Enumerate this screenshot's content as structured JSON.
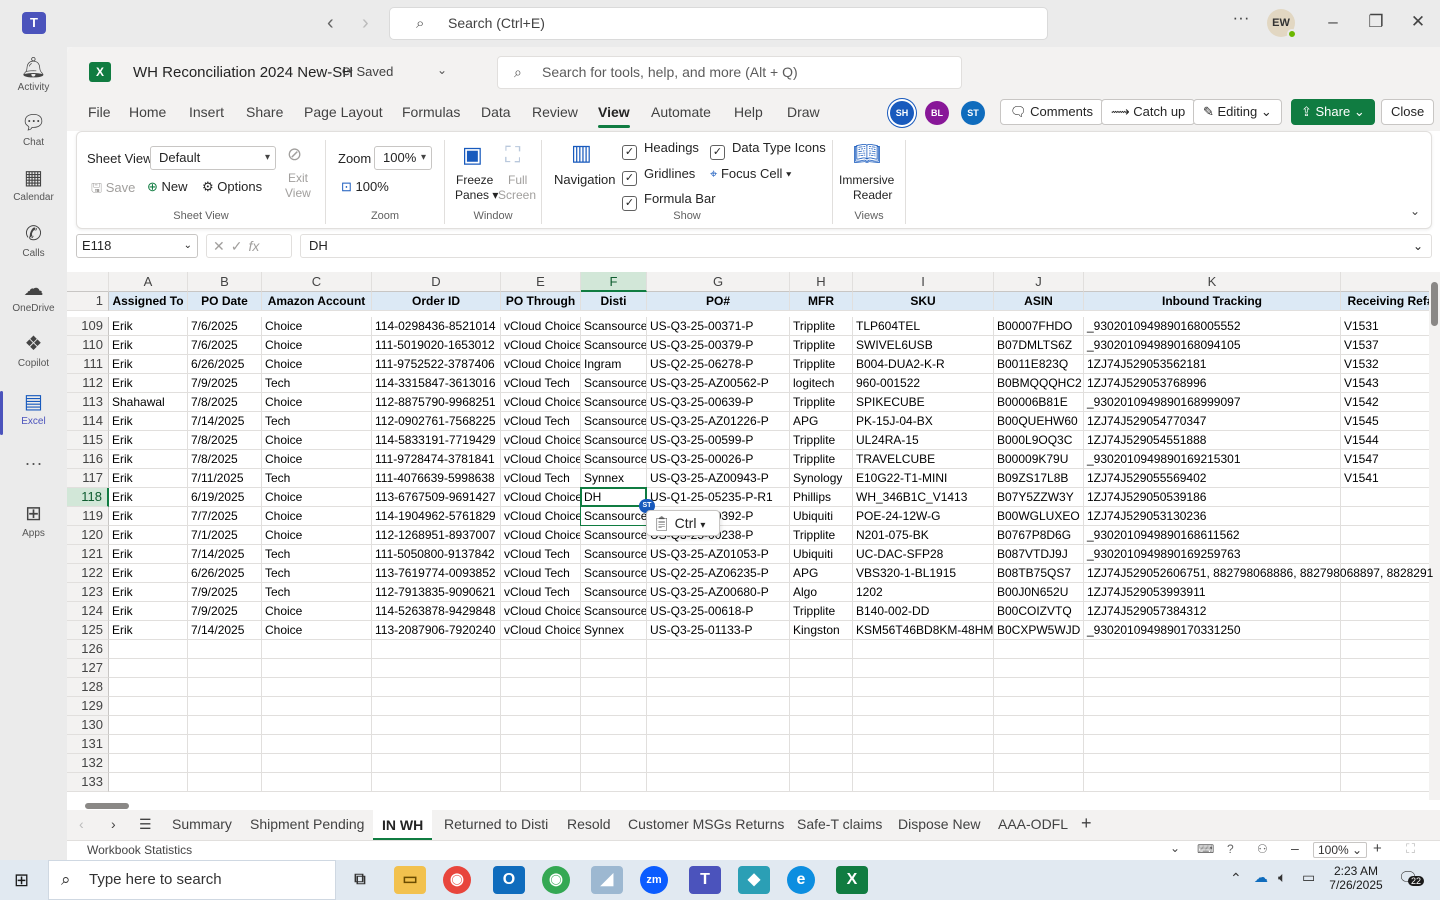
{
  "teams": {
    "search_placeholder": "Search (Ctrl+E)",
    "avatar_initials": "EW",
    "rail": [
      {
        "label": "Activity",
        "icon": "bell-icon"
      },
      {
        "label": "Chat",
        "icon": "chat-icon"
      },
      {
        "label": "Calendar",
        "icon": "calendar-icon"
      },
      {
        "label": "Calls",
        "icon": "phone-icon"
      },
      {
        "label": "OneDrive",
        "icon": "cloud-icon"
      },
      {
        "label": "Copilot",
        "icon": "copilot-icon"
      },
      {
        "label": "Excel",
        "icon": "excel-icon",
        "active": true
      },
      {
        "label": "Apps",
        "icon": "add-apps-icon"
      }
    ]
  },
  "excel": {
    "workbook_name": "WH Reconciliation 2024 New-SH",
    "save_status": "Saved",
    "search_placeholder": "Search for tools, help, and more (Alt + Q)",
    "tabs": [
      "File",
      "Home",
      "Insert",
      "Share",
      "Page Layout",
      "Formulas",
      "Data",
      "Review",
      "View",
      "Automate",
      "Help",
      "Draw"
    ],
    "active_tab": "View",
    "coauthors": [
      {
        "initials": "SH",
        "color": "#185abd"
      },
      {
        "initials": "BL",
        "color": "#881798"
      },
      {
        "initials": "ST",
        "color": "#0f6cbd"
      }
    ],
    "buttons": {
      "comments": "Comments",
      "catchup": "Catch up",
      "editing": "Editing",
      "share": "Share",
      "close": "Close"
    },
    "ribbon": {
      "sheet_view_label": "Sheet View",
      "sheet_view_value": "Default",
      "save": "Save",
      "new": "New",
      "options": "Options",
      "exit_view_1": "Exit",
      "exit_view_2": "View",
      "group_sheet_view": "Sheet View",
      "zoom_label": "Zoom",
      "zoom_value": "100%",
      "zoom_100": "100%",
      "group_zoom": "Zoom",
      "freeze_1": "Freeze",
      "freeze_2": "Panes",
      "full_1": "Full",
      "full_2": "Screen",
      "group_window": "Window",
      "navigation": "Navigation",
      "headings": "Headings",
      "gridlines": "Gridlines",
      "formula_bar": "Formula Bar",
      "data_type_icons": "Data Type Icons",
      "focus_cell": "Focus Cell",
      "group_show": "Show",
      "immersive_1": "Immersive",
      "immersive_2": "Reader",
      "group_views": "Views"
    },
    "name_box": "E118",
    "formula": "DH",
    "fx": "fx",
    "columns": [
      "A",
      "B",
      "C",
      "D",
      "E",
      "F",
      "G",
      "H",
      "I",
      "J",
      "K"
    ],
    "header_row": {
      "num": "1",
      "cells": [
        "Assigned To",
        "PO Date",
        "Amazon Account",
        "Order ID",
        "PO Through",
        "Disti",
        "PO#",
        "MFR",
        "SKU",
        "ASIN",
        "Inbound Tracking",
        "Receiving Ref#"
      ]
    },
    "rows": [
      {
        "num": "109",
        "cells": [
          "Erik",
          "7/6/2025",
          "Choice",
          "114-0298436-8521014",
          "vCloud Choice",
          "Scansource",
          "US-Q3-25-00371-P",
          "Tripplite",
          "TLP604TEL",
          "B00007FHDO",
          "_930201094989016800555​2",
          "V1531"
        ]
      },
      {
        "num": "110",
        "cells": [
          "Erik",
          "7/6/2025",
          "Choice",
          "111-5019020-1653012",
          "vCloud Choice",
          "Scansource",
          "US-Q3-25-00379-P",
          "Tripplite",
          "SWIVEL6USB",
          "B07DMLTS6Z",
          "_930201094989016809410​5",
          "V1537"
        ]
      },
      {
        "num": "111",
        "cells": [
          "Erik",
          "6/26/2025",
          "Choice",
          "111-9752522-3787406",
          "vCloud Choice",
          "Ingram",
          "US-Q2-25-06278-P",
          "Tripplite",
          "B004-DUA2-K-R",
          "B0011E823Q",
          "1ZJ74J529053562181",
          "V1532"
        ]
      },
      {
        "num": "112",
        "cells": [
          "Erik",
          "7/9/2025",
          "Tech",
          "114-3315847-3613016",
          "vCloud Tech",
          "Scansource",
          "US-Q3-25-AZ00562-P",
          "logitech",
          "960-001522",
          "B0BMQQQHC2",
          "1ZJ74J529053768996",
          "V1543"
        ]
      },
      {
        "num": "113",
        "cells": [
          "Shahawal",
          "7/8/2025",
          "Choice",
          "112-8875790-9968251",
          "vCloud Choice",
          "Scansource",
          "US-Q3-25-00639-P",
          "Tripplite",
          "SPIKECUBE",
          "B00006B81E",
          "_930201094989016899909​7",
          "V1542"
        ]
      },
      {
        "num": "114",
        "cells": [
          "Erik",
          "7/14/2025",
          "Tech",
          "112-0902761-7568225",
          "vCloud Tech",
          "Scansource",
          "US-Q3-25-AZ01226-P",
          "APG",
          "PK-15J-04-BX",
          "B00QUEHW60",
          "1ZJ74J529054770347",
          "V1545"
        ]
      },
      {
        "num": "115",
        "cells": [
          "Erik",
          "7/8/2025",
          "Choice",
          "114-5833191-7719429",
          "vCloud Choice",
          "Scansource",
          "US-Q3-25-00599-P",
          "Tripplite",
          "UL24RA-15",
          "B000L9OQ3C",
          "1ZJ74J529054551888",
          "V1544"
        ]
      },
      {
        "num": "116",
        "cells": [
          "Erik",
          "7/8/2025",
          "Choice",
          "111-9728474-3781841",
          "vCloud Choice",
          "Scansource",
          "US-Q3-25-00026-P",
          "Tripplite",
          "TRAVELCUBE",
          "B00009K79U",
          "_930201094989016921530​1",
          "V1547"
        ]
      },
      {
        "num": "117",
        "cells": [
          "Erik",
          "7/11/2025",
          "Tech",
          "111-4076639-5998638",
          "vCloud Tech",
          "Synnex",
          "US-Q3-25-AZ00943-P",
          "Synology",
          "E10G22-T1-MINI",
          "B09ZS17L8B",
          "1ZJ74J529055569402",
          "V1541"
        ]
      },
      {
        "num": "118",
        "cells": [
          "Erik",
          "6/19/2025",
          "Choice",
          "113-6767509-9691427",
          "vCloud Choice",
          "DH",
          "US-Q1-25-05235-P-R1",
          "Phillips",
          "WH_346B1C_V1413",
          "B07Y5ZZW3Y",
          "1ZJ74J529050539186",
          ""
        ]
      },
      {
        "num": "119",
        "cells": [
          "Erik",
          "7/7/2025",
          "Choice",
          "114-1904962-5761829",
          "vCloud Choice",
          "Scansource",
          "US-Q3-25-00392-P",
          "Ubiquiti",
          "POE-24-12W-G",
          "B00WGLUXEO",
          "1ZJ74J529053130236",
          ""
        ]
      },
      {
        "num": "120",
        "cells": [
          "Erik",
          "7/1/2025",
          "Choice",
          "112-1268951-8937007",
          "vCloud Choice",
          "Scansource",
          "US-Q3-25-00238-P",
          "Tripplite",
          "N201-075-BK",
          "B0767P8D6G",
          "_930201094989016861156​2",
          ""
        ]
      },
      {
        "num": "121",
        "cells": [
          "Erik",
          "7/14/2025",
          "Tech",
          "111-5050800-9137842",
          "vCloud Tech",
          "Scansource",
          "US-Q3-25-AZ01053-P",
          "Ubiquiti",
          "UC-DAC-SFP28",
          "B087VTDJ9J",
          "_930201094989016925976​3",
          ""
        ]
      },
      {
        "num": "122",
        "cells": [
          "Erik",
          "6/26/2025",
          "Tech",
          "113-7619774-0093852",
          "vCloud Tech",
          "Scansource",
          "US-Q2-25-AZ06235-P",
          "APG",
          "VBS320-1-BL1915",
          "B08TB75QS7",
          "1ZJ74J529052606751, 882798068886, 882798068897, 8828291",
          ""
        ]
      },
      {
        "num": "123",
        "cells": [
          "Erik",
          "7/9/2025",
          "Tech",
          "112-7913835-9090621",
          "vCloud Tech",
          "Scansource",
          "US-Q3-25-AZ00680-P",
          "Algo",
          "1202",
          "B00J0N652U",
          "1ZJ74J529053993911",
          ""
        ]
      },
      {
        "num": "124",
        "cells": [
          "Erik",
          "7/9/2025",
          "Choice",
          "114-5263878-9429848",
          "vCloud Choice",
          "Scansource",
          "US-Q3-25-00618-P",
          "Tripplite",
          "B140-002-DD",
          "B00COIZVTQ",
          "1ZJ74J529057384312",
          ""
        ]
      },
      {
        "num": "125",
        "cells": [
          "Erik",
          "7/14/2025",
          "Choice",
          "113-2087906-7920240",
          "vCloud Choice",
          "Synnex",
          "US-Q3-25-01133-P",
          "Kingston",
          "KSM56T46BD8KM-48HM",
          "B0CXPW5WJD",
          "_930201094989017033125​0",
          ""
        ]
      },
      {
        "num": "126",
        "cells": [
          "",
          "",
          "",
          "",
          "",
          "",
          "",
          "",
          "",
          "",
          "",
          ""
        ]
      },
      {
        "num": "127",
        "cells": [
          "",
          "",
          "",
          "",
          "",
          "",
          "",
          "",
          "",
          "",
          "",
          ""
        ]
      },
      {
        "num": "128",
        "cells": [
          "",
          "",
          "",
          "",
          "",
          "",
          "",
          "",
          "",
          "",
          "",
          ""
        ]
      },
      {
        "num": "129",
        "cells": [
          "",
          "",
          "",
          "",
          "",
          "",
          "",
          "",
          "",
          "",
          "",
          ""
        ]
      },
      {
        "num": "130",
        "cells": [
          "",
          "",
          "",
          "",
          "",
          "",
          "",
          "",
          "",
          "",
          "",
          ""
        ]
      },
      {
        "num": "131",
        "cells": [
          "",
          "",
          "",
          "",
          "",
          "",
          "",
          "",
          "",
          "",
          "",
          ""
        ]
      },
      {
        "num": "132",
        "cells": [
          "",
          "",
          "",
          "",
          "",
          "",
          "",
          "",
          "",
          "",
          "",
          ""
        ]
      },
      {
        "num": "133",
        "cells": [
          "",
          "",
          "",
          "",
          "",
          "",
          "",
          "",
          "",
          "",
          "",
          ""
        ]
      }
    ],
    "selected_cell": "E118",
    "coauthor_flag": "ST",
    "paste_popup": "Ctrl",
    "sheet_tabs": [
      "Summary",
      "Shipment Pending",
      "IN WH",
      "Returned to Disti",
      "Resold",
      "Customer MSGs Returns",
      "Safe-T claims",
      "Dispose New",
      "AAA-ODFL"
    ],
    "active_sheet": "IN WH",
    "status_left": "Workbook Statistics",
    "status_zoom": "100%"
  },
  "taskbar": {
    "search_placeholder": "Type here to search",
    "time": "2:23 AM",
    "date": "7/26/2025",
    "notif_count": "22"
  }
}
